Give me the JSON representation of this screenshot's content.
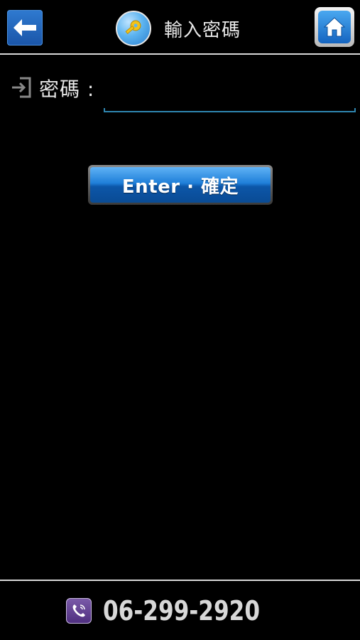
{
  "header": {
    "title": "輸入密碼",
    "back_icon": "back-arrow-icon",
    "home_icon": "home-icon",
    "title_icon": "key-icon"
  },
  "form": {
    "password_label": "密碼 :",
    "password_value": "",
    "label_icon": "sign-in-icon"
  },
  "actions": {
    "enter_label": "Enter · 確定"
  },
  "footer": {
    "phone": "06-299-2920",
    "phone_icon": "phone-icon"
  },
  "colors": {
    "background": "#000000",
    "accent_blue": "#1f7fd9",
    "input_underline": "#2f86b0",
    "phone_badge": "#5f3f90"
  }
}
